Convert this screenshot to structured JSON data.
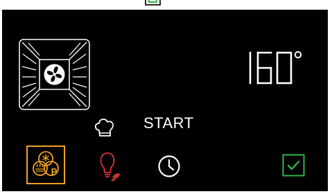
{
  "display": {
    "temperature_value": "160",
    "temperature_unit": "°",
    "start_label": "START"
  },
  "icons": {
    "oven_cavity": "oven-fan-icon",
    "chef": "chef-hat-icon",
    "mode": "multi-function-mode-icon",
    "mode_badge": "P",
    "light": "lightbulb-icon",
    "timer": "clock-icon",
    "confirm": "checkbox-icon"
  },
  "colors": {
    "panel_bg": "#000000",
    "text": "#ffffff",
    "mode_accent": "#f0a322",
    "light_accent": "#e0303e",
    "leaf_accent": "#c0392b",
    "confirm_accent": "#2fb84a"
  }
}
